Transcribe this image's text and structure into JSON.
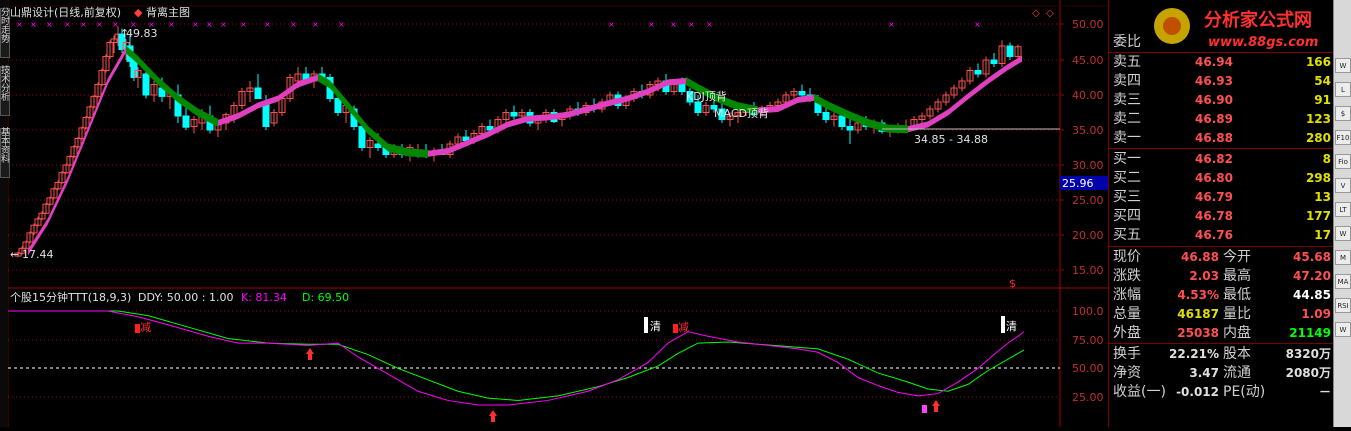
{
  "window": {
    "title": "山鼎设计(日线,前复权)",
    "indicator_name": "背离主图"
  },
  "left_tabs": [
    "分时走势",
    "技术分析",
    "基本资料"
  ],
  "watermark": {
    "brand": "分析家公式网",
    "url": "www.88gs.com"
  },
  "main_chart": {
    "y_ticks": [
      "50.00",
      "45.00",
      "40.00",
      "35.00",
      "30.00",
      "25.00",
      "20.00",
      "15.00"
    ],
    "current_price_label": "25.96",
    "high_label": "49.83",
    "low_label": "17.44",
    "range_label": "34.85 - 34.88",
    "annotation_kdj": "KDJ顶背",
    "annotation_macd": "MACD顶背",
    "dollar_mark": "$"
  },
  "sub_chart": {
    "indicator_label": "个股15分钟TTT(18,9,3)",
    "ddy_label": "DDY: 50.00 : 1.00",
    "k_label": "K: 81.34",
    "d_label": "D: 69.50",
    "y_ticks": [
      "100.0",
      "75.00",
      "50.00",
      "25.00"
    ],
    "signals": [
      "减",
      "清",
      "减",
      "清"
    ]
  },
  "quote": {
    "title": "委比",
    "sell": [
      {
        "label": "卖五",
        "price": "46.94",
        "vol": "166"
      },
      {
        "label": "卖四",
        "price": "46.93",
        "vol": "54"
      },
      {
        "label": "卖三",
        "price": "46.90",
        "vol": "91"
      },
      {
        "label": "卖二",
        "price": "46.89",
        "vol": "123"
      },
      {
        "label": "卖一",
        "price": "46.88",
        "vol": "280"
      }
    ],
    "buy": [
      {
        "label": "买一",
        "price": "46.82",
        "vol": "8"
      },
      {
        "label": "买二",
        "price": "46.80",
        "vol": "298"
      },
      {
        "label": "买三",
        "price": "46.79",
        "vol": "13"
      },
      {
        "label": "买四",
        "price": "46.78",
        "vol": "177"
      },
      {
        "label": "买五",
        "price": "46.76",
        "vol": "17"
      }
    ],
    "stats": [
      {
        "l1": "现价",
        "v1": "46.88",
        "c1": "#ff5050",
        "l2": "今开",
        "v2": "45.68",
        "c2": "#ff5050"
      },
      {
        "l1": "涨跌",
        "v1": "2.03",
        "c1": "#ff5050",
        "l2": "最高",
        "v2": "47.20",
        "c2": "#ff5050"
      },
      {
        "l1": "涨幅",
        "v1": "4.53%",
        "c1": "#ff5050",
        "l2": "最低",
        "v2": "44.85",
        "c2": "#ffffff"
      },
      {
        "l1": "总量",
        "v1": "46187",
        "c1": "#e0e000",
        "l2": "量比",
        "v2": "1.09",
        "c2": "#ff5050"
      },
      {
        "l1": "外盘",
        "v1": "25038",
        "c1": "#ff5050",
        "l2": "内盘",
        "v2": "21149",
        "c2": "#00ff00"
      }
    ],
    "fundamentals": [
      {
        "l1": "换手",
        "v1": "22.21%",
        "l2": "股本",
        "v2": "8320万"
      },
      {
        "l1": "净资",
        "v1": "3.47",
        "l2": "流通",
        "v2": "2080万"
      },
      {
        "l1": "收益(一)",
        "v1": "-0.012",
        "l2": "PE(动)",
        "v2": "－"
      }
    ]
  },
  "toolbar": [
    "W",
    "L",
    "$",
    "F10",
    "Fio",
    "V",
    "LT",
    "W",
    "M",
    "MA",
    "RSI",
    "W"
  ],
  "colors": {
    "up": "#ff5050",
    "down": "#00ffff",
    "ma_up": "#e040c0",
    "ma_down": "#008800",
    "k_line": "#ff00ff",
    "d_line": "#00ff00",
    "grid_red": "#ff0000"
  }
}
